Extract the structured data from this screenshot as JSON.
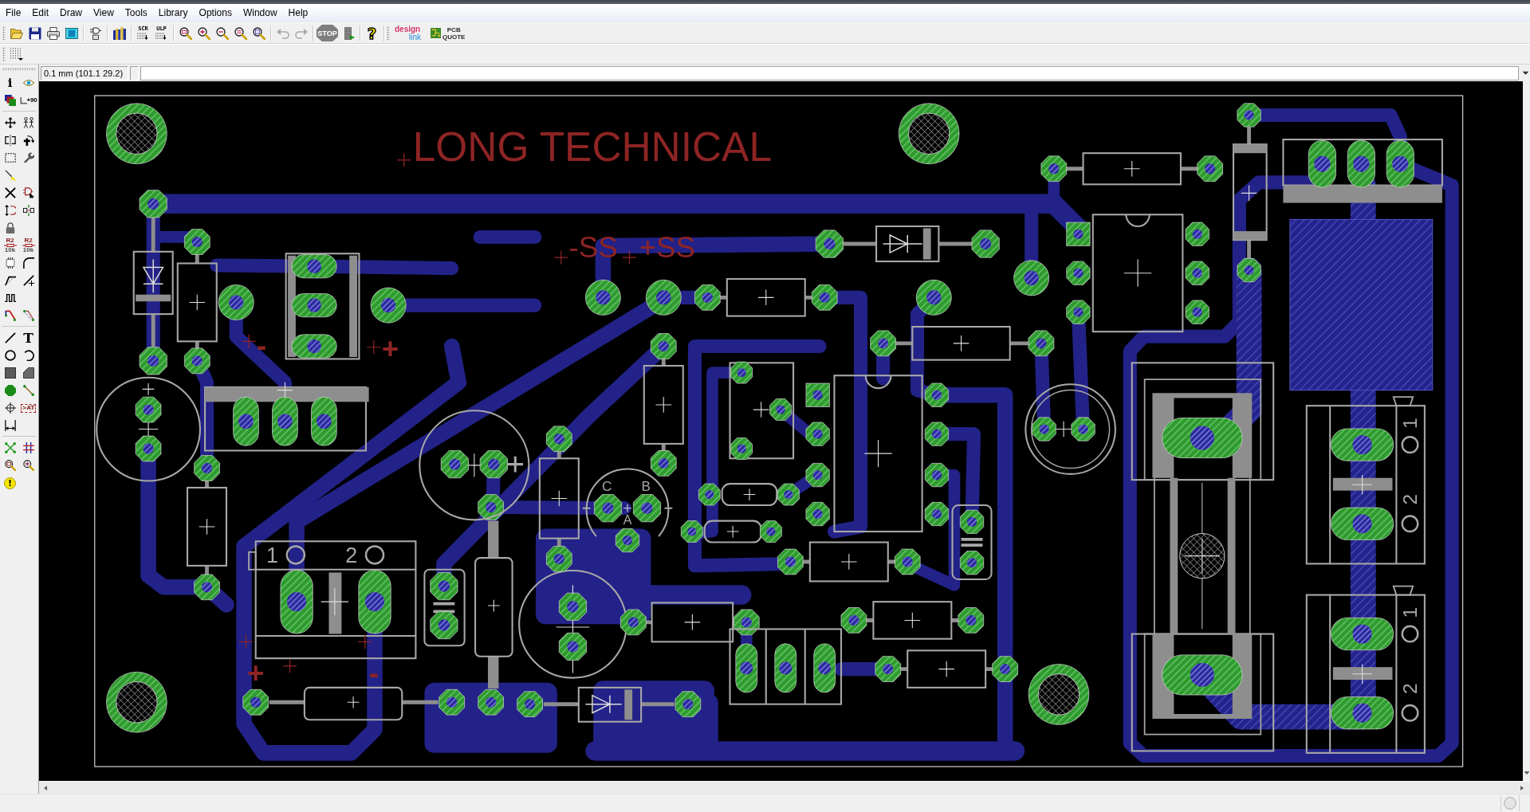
{
  "menu": [
    "File",
    "Edit",
    "Draw",
    "View",
    "Tools",
    "Library",
    "Options",
    "Window",
    "Help"
  ],
  "toolbar": {
    "script": {
      "caption": "SCR"
    },
    "ulp": {
      "caption": "ULP"
    },
    "undo": {
      "disabled": true
    },
    "redo": {
      "disabled": true
    },
    "stop": {
      "caption": "STOP",
      "disabled": true
    },
    "help": {
      "symbol": "?"
    },
    "logos": [
      {
        "top": "design",
        "bottom": "link"
      },
      {
        "top": "PCB",
        "bottom": "QUOTE"
      }
    ]
  },
  "command_bar": {
    "coordinates": "0.1 mm (101.1 29.2)"
  },
  "side_toolbar": {
    "captions": [
      "i",
      "+90",
      "R2",
      "R2",
      "10k",
      "10k",
      "T",
      ">AT",
      "!"
    ]
  },
  "board": {
    "title": "LONG TECHNICAL",
    "net_labels": [
      "-SS",
      "+SS"
    ],
    "polarity_marks": [
      "-",
      "+",
      "+",
      "-"
    ],
    "terminal_block": {
      "pins": [
        "1",
        "2"
      ]
    },
    "transistor_pins": [
      "C",
      "B",
      "A"
    ],
    "screw_terminals": [
      {
        "pins": [
          "1",
          "2"
        ]
      },
      {
        "pins": [
          "1",
          "2"
        ]
      }
    ]
  }
}
